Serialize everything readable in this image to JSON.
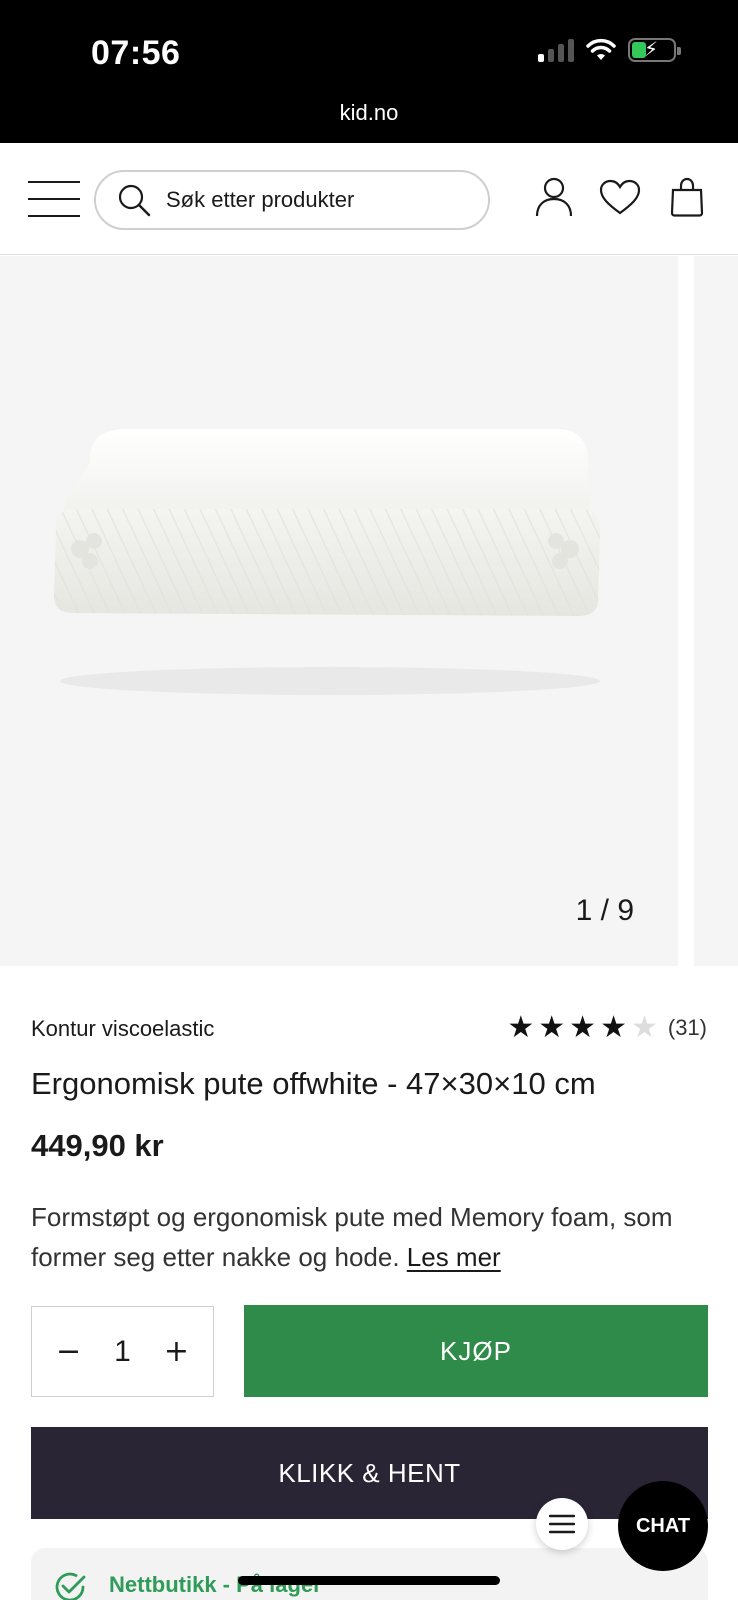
{
  "status_bar": {
    "time": "07:56",
    "url": "kid.no",
    "icons": [
      "signal-icon",
      "wifi-icon",
      "battery-charging-icon"
    ]
  },
  "header": {
    "search_placeholder": "Søk etter produkter",
    "icons": [
      "menu-icon",
      "search-icon",
      "account-icon",
      "heart-icon",
      "bag-icon"
    ]
  },
  "gallery": {
    "counter": "1 / 9",
    "current": 1,
    "total": 9
  },
  "product": {
    "brand": "Kontur viscoelastic",
    "rating": {
      "stars": 4,
      "max": 5,
      "count_label": "(31)"
    },
    "title": "Ergonomisk pute offwhite - 47×30×10 cm",
    "price": "449,90 kr",
    "description": "Formstøpt og ergonomisk pute med Memory foam, som former seg etter nakke og hode.",
    "read_more": "Les mer"
  },
  "actions": {
    "quantity": "1",
    "minus": "−",
    "plus": "+",
    "buy_label": "KJØP",
    "click_collect_label": "KLIKK & HENT"
  },
  "stock": {
    "text": "Nettbutikk - På lager"
  },
  "floating": {
    "chat_label": "CHAT"
  },
  "colors": {
    "buy_button": "#2e8b4a",
    "click_collect_button": "#2a2535",
    "stock_text": "#2e9b58",
    "status_bar": "#000000"
  }
}
